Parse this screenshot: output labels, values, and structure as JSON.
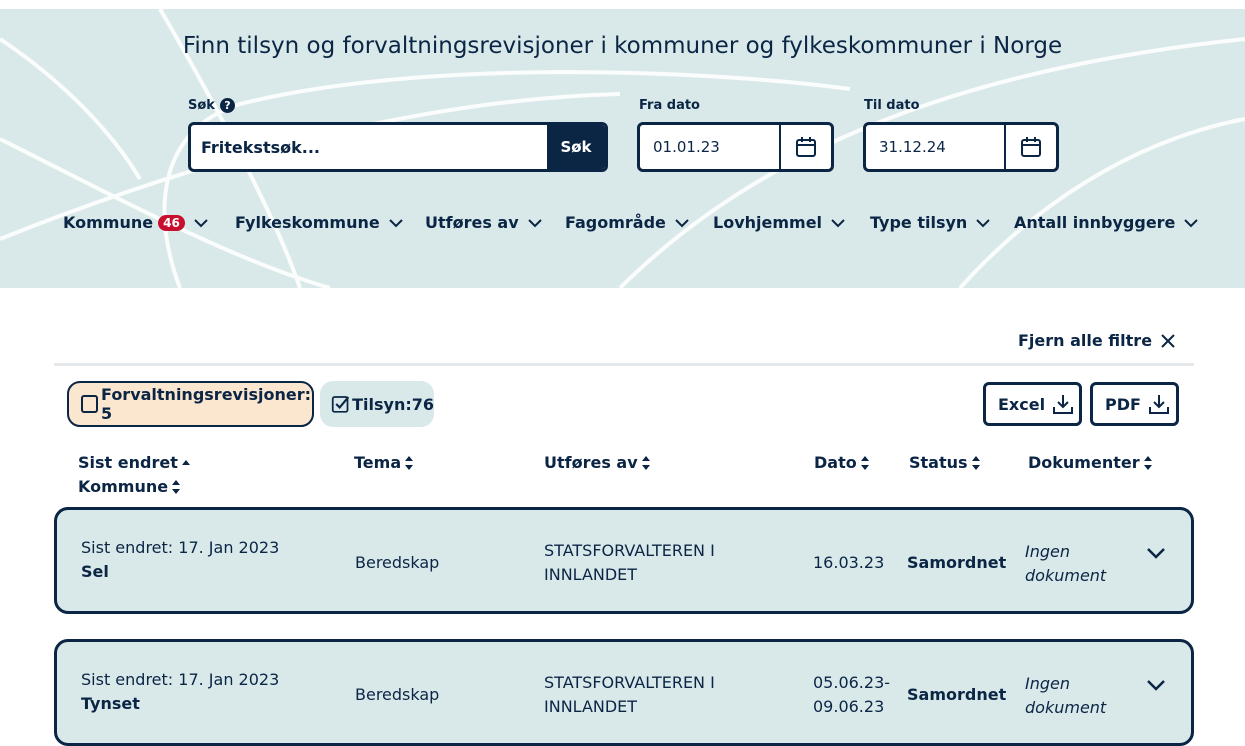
{
  "hero": {
    "title": "Finn tilsyn og forvaltningsrevisjoner i kommuner og fylkeskommuner i Norge",
    "search_label": "Søk",
    "search_placeholder": "Fritekstsøk...",
    "search_button": "Søk",
    "from_label": "Fra dato",
    "from_value": "01.01.23",
    "to_label": "Til dato",
    "to_value": "31.12.24"
  },
  "filters": [
    {
      "label": "Kommune",
      "badge": "46"
    },
    {
      "label": "Fylkeskommune"
    },
    {
      "label": "Utføres av"
    },
    {
      "label": "Fagområde"
    },
    {
      "label": "Lovhjemmel"
    },
    {
      "label": "Type tilsyn"
    },
    {
      "label": "Antall innbyggere"
    }
  ],
  "clear_filters": "Fjern alle filtre",
  "toggles": {
    "forvaltning": "Forvaltningsrevisjoner: 5",
    "tilsyn": "Tilsyn:76",
    "forvaltning_checked": false,
    "tilsyn_checked": true
  },
  "export": {
    "excel": "Excel",
    "pdf": "PDF"
  },
  "columns": {
    "sist_endret": "Sist endret",
    "kommune": "Kommune",
    "tema": "Tema",
    "utfores_av": "Utføres av",
    "dato": "Dato",
    "status": "Status",
    "dokumenter": "Dokumenter"
  },
  "rows": [
    {
      "changed": "Sist endret: 17. Jan 2023",
      "name": "Sel",
      "tema": "Beredskap",
      "utfores_1": "STATSFORVALTEREN I",
      "utfores_2": "INNLANDET",
      "dato_1": "16.03.23",
      "dato_2": "",
      "status": "Samordnet",
      "doc_1": "Ingen",
      "doc_2": "dokument"
    },
    {
      "changed": "Sist endret: 17. Jan 2023",
      "name": "Tynset",
      "tema": "Beredskap",
      "utfores_1": "STATSFORVALTEREN I",
      "utfores_2": "INNLANDET",
      "dato_1": "05.06.23-",
      "dato_2": "09.06.23",
      "status": "Samordnet",
      "doc_1": "Ingen",
      "doc_2": "dokument"
    }
  ],
  "colors": {
    "navy": "#0b2545",
    "hero_bg": "#d9e9ea",
    "badge": "#c8102e",
    "pill_active": "#fbe6cf"
  }
}
